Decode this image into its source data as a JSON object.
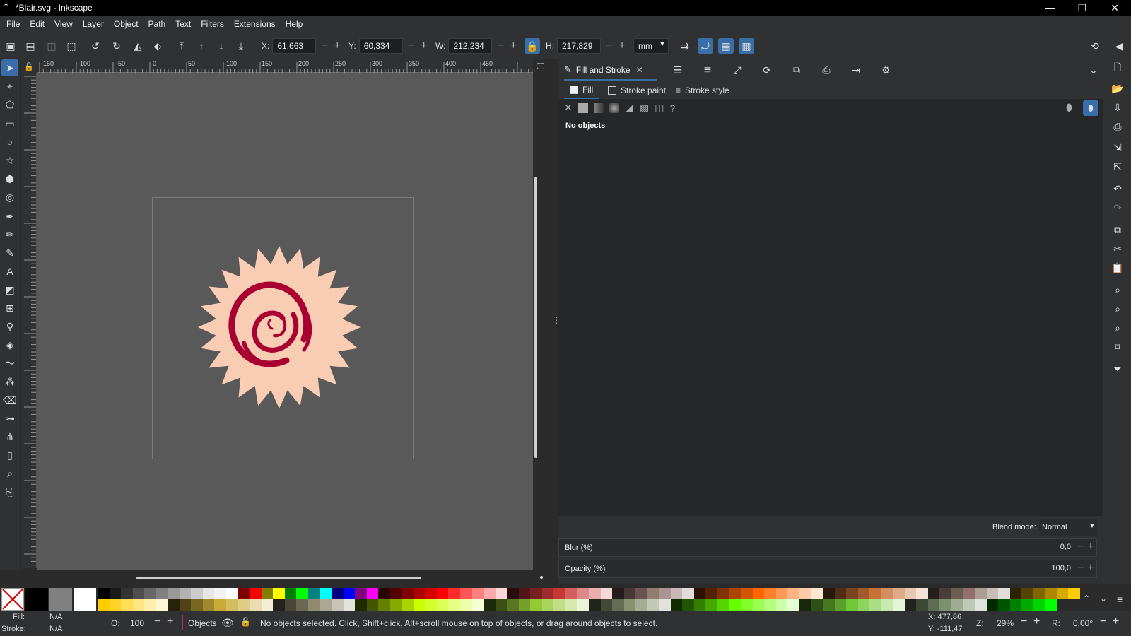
{
  "window": {
    "title": "*Blair.svg - Inkscape",
    "minimize": "—",
    "restore": "❐",
    "close": "✕"
  },
  "menu": [
    "File",
    "Edit",
    "View",
    "Layer",
    "Object",
    "Path",
    "Text",
    "Filters",
    "Extensions",
    "Help"
  ],
  "toolbar": {
    "x_label": "X:",
    "x_value": "61,663",
    "y_label": "Y:",
    "y_value": "60,334",
    "w_label": "W:",
    "w_value": "212,234",
    "h_label": "H:",
    "h_value": "217,829",
    "unit": "mm"
  },
  "ruler": {
    "h_ticks": [
      "-150",
      "-100",
      "-50",
      "0",
      "50",
      "100",
      "150",
      "200",
      "250",
      "300",
      "350",
      "400",
      "450"
    ],
    "v_ticks": [
      "-150",
      "-100",
      "-50",
      "0",
      "50",
      "100",
      "150",
      "200",
      "250",
      "300",
      "350",
      "400",
      "450"
    ]
  },
  "panel": {
    "tab_title": "Fill and Stroke",
    "subtabs": {
      "fill": "Fill",
      "stroke_paint": "Stroke paint",
      "stroke_style": "Stroke style"
    },
    "no_objects": "No objects",
    "blend_label": "Blend mode:",
    "blend_value": "Normal",
    "blur_label": "Blur (%)",
    "blur_value": "0,0",
    "opacity_label": "Opacity (%)",
    "opacity_value": "100,0"
  },
  "status": {
    "fill_label": "Fill:",
    "fill_value": "N/A",
    "stroke_label": "Stroke:",
    "stroke_value": "N/A",
    "o_label": "O:",
    "o_value": "100",
    "layer": "Objects",
    "message": "No objects selected. Click, Shift+click, Alt+scroll mouse on top of objects, or drag around objects to select.",
    "x_coord": "X: 477,86",
    "y_coord": "Y: -111,47",
    "zoom_label": "Z:",
    "zoom": "29%",
    "rot_label": "R:",
    "rotation": "0,00°"
  },
  "colors": {
    "accent": "#3a6ea8",
    "logo_fill": "#f9cdb3",
    "logo_swirl": "#a80030"
  },
  "palette_top": [
    "#000000",
    "#1a1a1a",
    "#333333",
    "#4d4d4d",
    "#666666",
    "#808080",
    "#999999",
    "#b3b3b3",
    "#cccccc",
    "#e6e6e6",
    "#f2f2f2",
    "#ffffff",
    "#800000",
    "#ff0000",
    "#808000",
    "#ffff00",
    "#008000",
    "#00ff00",
    "#008080",
    "#00ffff",
    "#000080",
    "#0000ff",
    "#800080",
    "#ff00ff",
    "#2b0000",
    "#550000",
    "#800000",
    "#aa0000",
    "#d40000",
    "#ff0000",
    "#ff2a2a",
    "#ff5555",
    "#ff8080",
    "#ffaaaa",
    "#ffd5d5",
    "#280b0b",
    "#501616",
    "#782121",
    "#a02c2c",
    "#c83737",
    "#d35f5f",
    "#de8787",
    "#e9afaf",
    "#f4d7d7",
    "#241c1c",
    "#483737",
    "#6c5353",
    "#917c6f",
    "#ac9393",
    "#c8b7b7",
    "#e3dbdb",
    "#2b1100",
    "#552200",
    "#803300",
    "#aa4400",
    "#d45500",
    "#ff6600",
    "#ff7f2a",
    "#ff9955",
    "#ffb380",
    "#ffccaa",
    "#ffe6d5",
    "#28170b",
    "#502d16",
    "#784421",
    "#a05a2c",
    "#c87137",
    "#d38d5f",
    "#deaa87",
    "#e9c6af",
    "#f4e3d7",
    "#241f1c",
    "#483e37",
    "#6c5d53",
    "#916f6f",
    "#ac9d93",
    "#c8beb7",
    "#e3dedb",
    "#2b2200",
    "#554400",
    "#806600",
    "#aa8800",
    "#d4aa00",
    "#ffcc00"
  ],
  "palette_bottom": [
    "#ffcc00",
    "#ffd42a",
    "#ffdd55",
    "#ffe680",
    "#ffeeaa",
    "#fff6d5",
    "#28220b",
    "#504416",
    "#786721",
    "#a0892c",
    "#c8ab37",
    "#d3bc5f",
    "#decd87",
    "#e9ddaf",
    "#f4eed7",
    "#24221c",
    "#484537",
    "#6c6753",
    "#918a6f",
    "#aca793",
    "#c8c4b7",
    "#e3e2db",
    "#222b00",
    "#445500",
    "#668000",
    "#88aa00",
    "#aad400",
    "#ccff00",
    "#d4ff2a",
    "#ddff55",
    "#e5ff80",
    "#eeffaa",
    "#f6ffd5",
    "#1e280b",
    "#3c5016",
    "#597821",
    "#76a02c",
    "#94c837",
    "#abd35f",
    "#c1de87",
    "#d8e9af",
    "#ecf4d7",
    "#22241c",
    "#444837",
    "#666c53",
    "#88916f",
    "#a5ac93",
    "#c4c8b7",
    "#e1e3db",
    "#112b00",
    "#225500",
    "#338000",
    "#44aa00",
    "#55d400",
    "#66ff00",
    "#7fff2a",
    "#99ff55",
    "#b3ff80",
    "#ccffaa",
    "#e5ffd5",
    "#17280b",
    "#2d5016",
    "#447821",
    "#5aa02c",
    "#71c837",
    "#8dd35f",
    "#aade87",
    "#c6e9af",
    "#e3f4d7",
    "#1f241c",
    "#3e4837",
    "#5d6c53",
    "#7c916f",
    "#9dac93",
    "#bec8b7",
    "#dee3db",
    "#002b00",
    "#005500",
    "#008000",
    "#00aa00",
    "#00d400",
    "#00ff00"
  ]
}
